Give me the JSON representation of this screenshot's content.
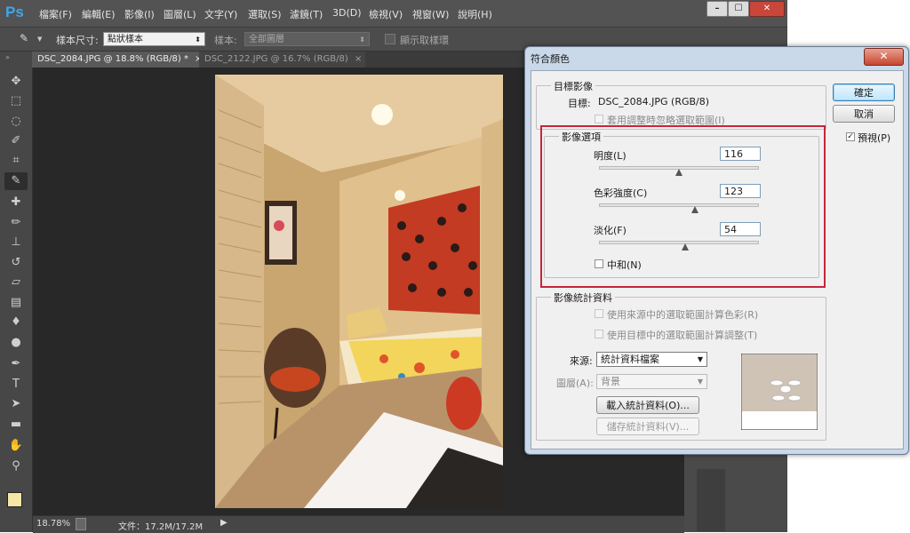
{
  "app": {
    "logo": "Ps",
    "menus": [
      "檔案(F)",
      "編輯(E)",
      "影像(I)",
      "圖層(L)",
      "文字(Y)",
      "選取(S)",
      "濾鏡(T)",
      "3D(D)",
      "檢視(V)",
      "視窗(W)",
      "說明(H)"
    ],
    "window_buttons": [
      "–",
      "☐",
      "✕"
    ]
  },
  "options_bar": {
    "sample_size_label": "樣本尺寸:",
    "sample_size_value": "點狀樣本",
    "sample_label": "樣本:",
    "sample_value": "全部圖層",
    "show_ring_label": "顯示取樣環"
  },
  "tabs": [
    {
      "label": "DSC_2084.JPG @ 18.8% (RGB/8) *",
      "close": "×"
    },
    {
      "label": "DSC_2122.JPG @ 16.7% (RGB/8)",
      "close": "×"
    }
  ],
  "status": {
    "zoom": "18.78%",
    "doc": "文件：17.2M/17.2M"
  },
  "dialog": {
    "title": "符合顏色",
    "close": "✕",
    "target_group": {
      "legend": "目標影像",
      "target_label": "目標:",
      "target_value": "DSC_2084.JPG (RGB/8)",
      "ignore_selection": "套用調整時忽略選取範圍(I)"
    },
    "image_options": {
      "legend": "影像選項",
      "luminance_label": "明度(L)",
      "luminance_value": "116",
      "luminance_level": 0.5,
      "color_intensity_label": "色彩強度(C)",
      "color_intensity_value": "123",
      "color_intensity_level": 0.6,
      "fade_label": "淡化(F)",
      "fade_value": "54",
      "fade_level": 0.54,
      "neutralize_label": "中和(N)"
    },
    "statistics": {
      "legend": "影像統計資料",
      "use_source_selection": "使用來源中的選取範圍計算色彩(R)",
      "use_target_selection": "使用目標中的選取範圍計算調整(T)",
      "source_label": "來源:",
      "source_value": "統計資料檔案",
      "layer_label": "圖層(A):",
      "layer_value": "背景",
      "load_button": "載入統計資料(O)...",
      "save_button": "儲存統計資料(V)..."
    },
    "ok_button": "確定",
    "cancel_button": "取消",
    "preview_label": "預視(P)",
    "preview_checked": true,
    "check_mark": "✓",
    "arrow": "▼"
  }
}
